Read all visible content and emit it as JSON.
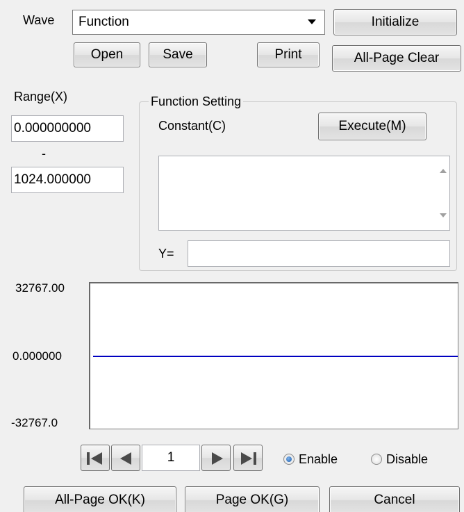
{
  "wave": {
    "label": "Wave",
    "selected": "Function"
  },
  "buttons": {
    "initialize": "Initialize",
    "open": "Open",
    "save": "Save",
    "print": "Print",
    "all_page_clear": "All-Page Clear",
    "execute": "Execute(M)",
    "all_page_ok": "All-Page OK(K)",
    "page_ok": "Page OK(G)",
    "cancel": "Cancel"
  },
  "range": {
    "label": "Range(X)",
    "min": "0.000000000",
    "separator": "-",
    "max": "1024.000000"
  },
  "function_setting": {
    "title": "Function Setting",
    "constant_label": "Constant(C)",
    "constant_value": "",
    "y_label": "Y=",
    "y_value": ""
  },
  "plot": {
    "y_max": "32767.00",
    "y_zero": "0.000000",
    "y_min": "-32767.0",
    "line_color": "#0000c0"
  },
  "pager": {
    "page": "1",
    "enable_label": "Enable",
    "disable_label": "Disable",
    "selected": "Enable"
  },
  "icons": {
    "first": "first-page-icon",
    "prev": "previous-page-icon",
    "next": "next-page-icon",
    "last": "last-page-icon",
    "dropdown": "chevron-down-icon"
  }
}
